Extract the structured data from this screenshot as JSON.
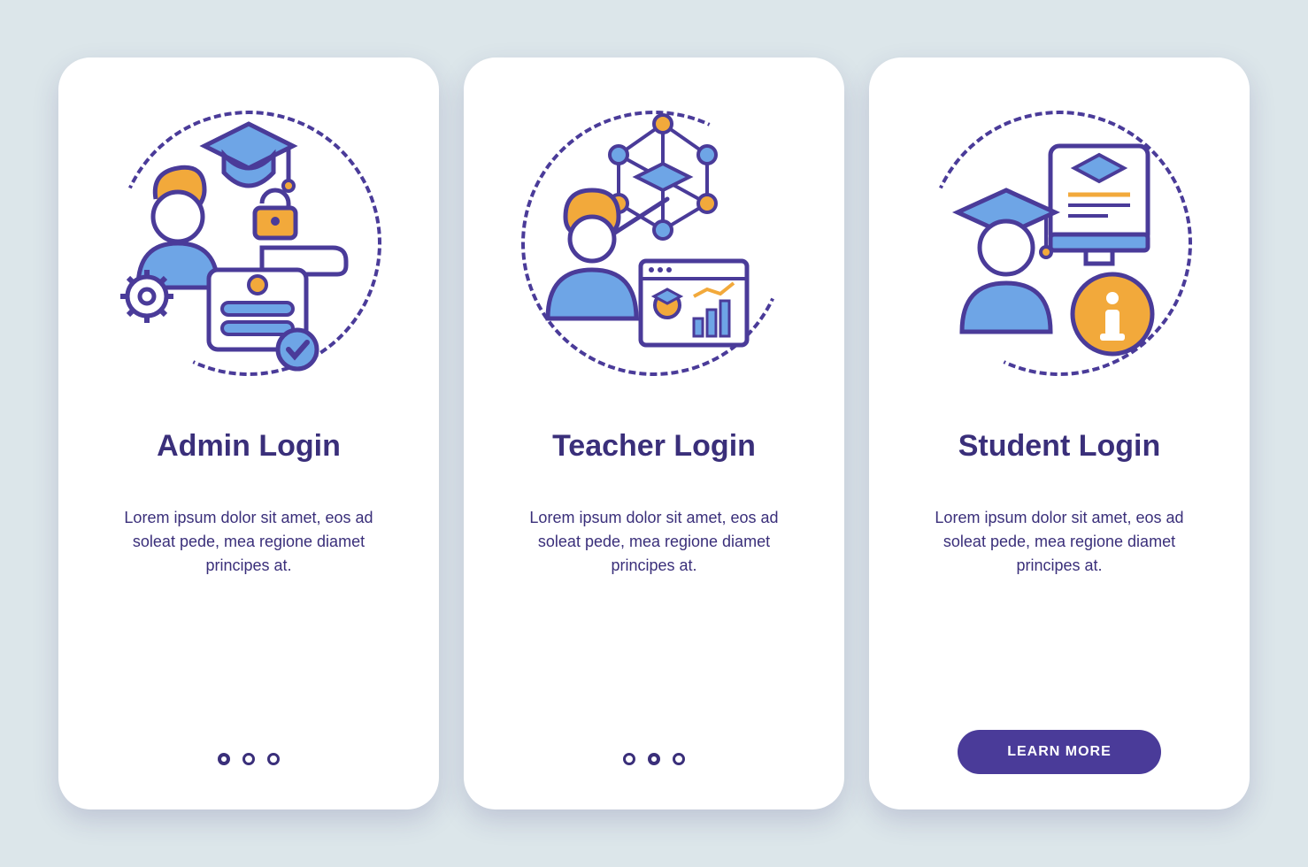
{
  "colors": {
    "bg": "#dce6ea",
    "card": "#ffffff",
    "primary": "#3a2f7a",
    "accent_blue": "#6ea5e6",
    "accent_orange": "#f2a93b",
    "stroke": "#4a3b99"
  },
  "cards": [
    {
      "id": "admin",
      "title": "Admin Login",
      "description": "Lorem ipsum dolor sit amet, eos ad soleat pede, mea regione diamet principes at.",
      "active_dot_index": 0,
      "cta_label": null,
      "icons": [
        "person-icon",
        "graduation-cap-icon",
        "padlock-icon",
        "hand-icon",
        "gear-icon",
        "login-form-icon",
        "checkmark-icon"
      ]
    },
    {
      "id": "teacher",
      "title": "Teacher Login",
      "description": "Lorem ipsum dolor sit amet, eos ad soleat pede, mea regione diamet principes at.",
      "active_dot_index": 1,
      "cta_label": null,
      "icons": [
        "teacher-person-icon",
        "pointer-stick-icon",
        "network-graph-icon",
        "graduation-cap-icon",
        "analytics-window-icon"
      ]
    },
    {
      "id": "student",
      "title": "Student Login",
      "description": "Lorem ipsum dolor sit amet, eos ad soleat pede, mea regione diamet principes at.",
      "active_dot_index": null,
      "cta_label": "LEARN MORE",
      "icons": [
        "student-person-icon",
        "graduation-cap-icon",
        "document-monitor-icon",
        "info-icon"
      ]
    }
  ],
  "page_indicator": {
    "total": 3
  }
}
